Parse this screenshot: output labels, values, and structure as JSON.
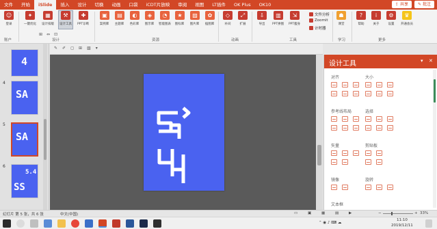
{
  "menu": {
    "tabs": [
      "文件",
      "开始",
      "iSlide",
      "插入",
      "设计",
      "切换",
      "动画",
      "口袋",
      "iCDT片放映",
      "审阅",
      "视图",
      "LT插件",
      "OK Plus",
      "OK10"
    ],
    "active_tab": "iSlide",
    "share_label": "共享",
    "comment_label": "批注"
  },
  "ribbon": {
    "buttons": [
      {
        "label": "登录",
        "color": "#c63c30"
      },
      {
        "label": "一键优化",
        "color": "#c63c30"
      },
      {
        "label": "设计排版",
        "color": "#c63c30"
      },
      {
        "label": "设计工具",
        "color": "#c63c30",
        "selected": true
      },
      {
        "label": "PPT诊断",
        "color": "#c63c30"
      },
      {
        "label": "案例库",
        "color": "#e8633e"
      },
      {
        "label": "主题库",
        "color": "#e8633e"
      },
      {
        "label": "色彩库",
        "color": "#e8633e"
      },
      {
        "label": "图示库",
        "color": "#e8633e"
      },
      {
        "label": "智能图表",
        "color": "#e8633e"
      },
      {
        "label": "图标库",
        "color": "#e8633e"
      },
      {
        "label": "图片库",
        "color": "#e8633e"
      },
      {
        "label": "插图库",
        "color": "#e8633e"
      },
      {
        "label": "补间",
        "color": "#c63c30"
      },
      {
        "label": "扩展",
        "color": "#c63c30"
      },
      {
        "label": "导出",
        "color": "#c63c30"
      },
      {
        "label": "PPT拼图",
        "color": "#c63c30"
      },
      {
        "label": "PPT瘦身",
        "color": "#c63c30"
      },
      {
        "label": "课堂",
        "color": "#f0a030"
      },
      {
        "label": "帮助",
        "color": "#c63c30"
      },
      {
        "label": "关于",
        "color": "#c63c30"
      },
      {
        "label": "设置",
        "color": "#c63c30"
      },
      {
        "label": "开通会员",
        "color": "#f5c518"
      }
    ],
    "mini_items": [
      "文件分析",
      "Zoomit",
      "计时器"
    ],
    "groups": [
      "账户",
      "设计",
      "资源",
      "动画",
      "工具",
      "学习",
      "更多"
    ]
  },
  "thumbnails": [
    {
      "number": "",
      "glyph": "4"
    },
    {
      "number": "4",
      "glyph": "SA"
    },
    {
      "number": "5",
      "glyph": "SA",
      "selected": true
    },
    {
      "number": "6",
      "glyph": "5.4"
    }
  ],
  "thumb6_text": "5.4",
  "slide": {
    "background": "#4a62f0"
  },
  "design_panel": {
    "title": "设计工具",
    "sections": [
      "对齐",
      "大小",
      "参考线布局",
      "选择",
      "矢量",
      "剪贴板",
      "旋转",
      "镜像",
      "文本框"
    ]
  },
  "status": {
    "slide_info": "幻灯片 第 5 张，共 6 张",
    "language": "中文(中国)",
    "zoom": "33%"
  },
  "taskbar": {
    "time": "11:10",
    "date": "2019/12/11"
  }
}
